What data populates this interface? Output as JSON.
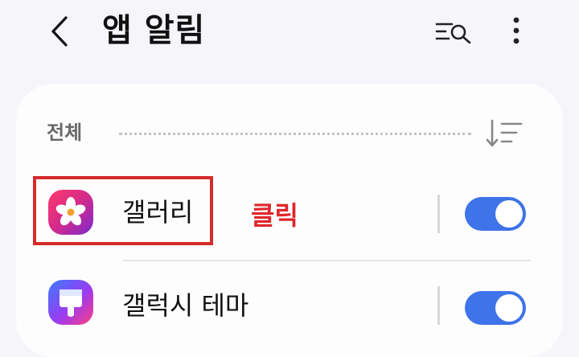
{
  "header": {
    "title": "앱 알림",
    "back_icon": "chevron-left-icon",
    "search_icon": "list-search-icon",
    "more_icon": "more-vertical-icon"
  },
  "section": {
    "label": "전체",
    "sort_icon": "sort-descending-icon"
  },
  "apps": [
    {
      "name": "갤러리",
      "icon": "gallery-flower-icon",
      "enabled": true
    },
    {
      "name": "갤럭시 테마",
      "icon": "galaxy-themes-brush-icon",
      "enabled": true
    }
  ],
  "annotation": {
    "label": "클릭",
    "color": "#e0262b"
  },
  "colors": {
    "toggle_on": "#3e73e9",
    "background": "#f6f5fa",
    "card": "#fdfdfe"
  }
}
